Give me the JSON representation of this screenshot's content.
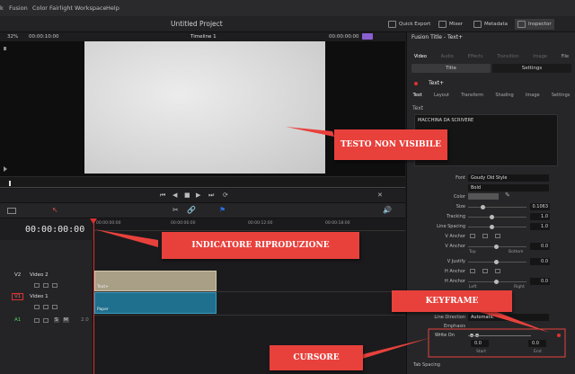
{
  "menu": {
    "items": [
      "k",
      "Fusion",
      "Color",
      "Fairlight",
      "Workspace",
      "Help"
    ]
  },
  "project_title": "Untitled Project",
  "topbar": {
    "zoom": "32%",
    "timecode_left": "00:00:10:00",
    "timeline_name": "Timeline 1",
    "timecode_right": "00:00:00:00",
    "buttons": [
      "Quick Export",
      "Mixer",
      "Metadata",
      "Inspector"
    ]
  },
  "inspector": {
    "title": "Fusion Title - Text+",
    "top_tabs": [
      "Video",
      "Audio",
      "Effects",
      "Transition",
      "Image",
      "File"
    ],
    "sub_tabs": [
      "Title",
      "Settings"
    ],
    "node_name": "Text+",
    "tool_tabs": [
      "Text",
      "Layout",
      "Transform",
      "Shading",
      "Image",
      "Settings"
    ],
    "section_text": "Text",
    "text_content": "MACCHINA DA SCRIVERE",
    "font_label": "Font",
    "font_value": "Goudy Old Style",
    "style_value": "Bold",
    "props": [
      {
        "label": "Color",
        "value": ""
      },
      {
        "label": "Size",
        "value": "0.1063"
      },
      {
        "label": "Tracking",
        "value": "1.0"
      },
      {
        "label": "Line Spacing",
        "value": "1.0"
      },
      {
        "label": "V Anchor",
        "value": ""
      },
      {
        "label": "V Anchor",
        "value": "0.0"
      },
      {
        "label": "V Justify",
        "value": "0.0"
      },
      {
        "label": "H Anchor",
        "value": ""
      },
      {
        "label": "H Anchor",
        "value": "0.0"
      }
    ],
    "anchor_top": "Top",
    "anchor_bottom": "Bottom",
    "anchor_left": "Left",
    "anchor_right": "Right",
    "line_direction_label": "Line Direction",
    "line_direction_value": "Automatic",
    "emphasis_label": "Emphasis",
    "write_on_label": "Write On",
    "write_on_start": "0.0",
    "write_on_end": "0.0",
    "start_label": "Start",
    "end_label": "End",
    "tab_spacing": "Tab Spacing"
  },
  "timeline": {
    "timecode": "00:00:00:00",
    "ruler": [
      "00:00:00:00",
      "00:00:06:00",
      "00:00:12:00",
      "00:00:18:00"
    ],
    "tracks": [
      {
        "id": "V2",
        "name": "Video 2"
      },
      {
        "id": "V1",
        "name": "Video 1"
      },
      {
        "id": "A1",
        "name": ""
      }
    ],
    "clips": {
      "text_clip": "Text+",
      "paper_clip": "Paper"
    },
    "a1_level": "2.0"
  },
  "callouts": {
    "text_invisible": "TESTO NON VISIBILE",
    "playhead_indicator": "INDICATORE RIPRODUZIONE",
    "keyframe": "KEYFRAME",
    "cursor": "CURSORE"
  },
  "colors": {
    "accent_red": "#e8413c",
    "clip_title": "#a89f86",
    "clip_video": "#1f6f8e"
  }
}
